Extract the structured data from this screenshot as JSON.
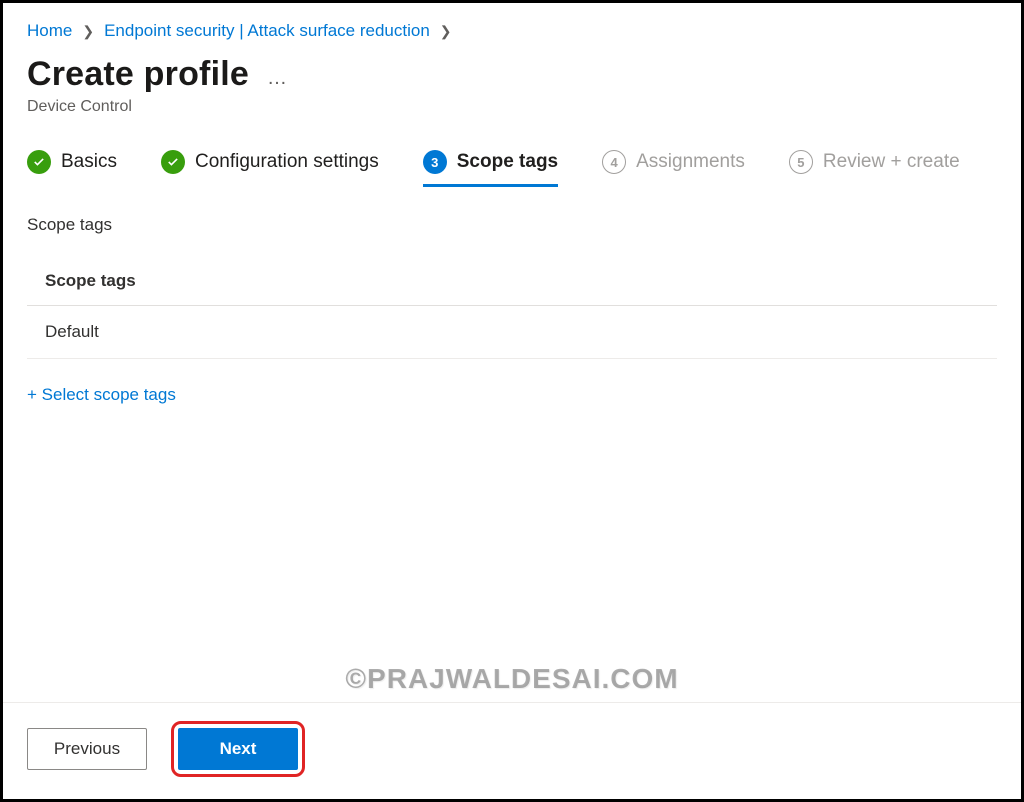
{
  "breadcrumb": {
    "home": "Home",
    "section": "Endpoint security | Attack surface reduction"
  },
  "page": {
    "title": "Create profile",
    "subtitle": "Device Control"
  },
  "stepper": {
    "steps": [
      {
        "label": "Basics",
        "state": "done"
      },
      {
        "label": "Configuration settings",
        "state": "done"
      },
      {
        "number": "3",
        "label": "Scope tags",
        "state": "active"
      },
      {
        "number": "4",
        "label": "Assignments",
        "state": "future"
      },
      {
        "number": "5",
        "label": "Review + create",
        "state": "future"
      }
    ]
  },
  "section": {
    "label": "Scope tags",
    "table_header": "Scope tags",
    "rows": [
      "Default"
    ],
    "select_link": "+ Select scope tags"
  },
  "footer": {
    "previous": "Previous",
    "next": "Next"
  },
  "watermark": "©PRAJWALDESAI.COM"
}
